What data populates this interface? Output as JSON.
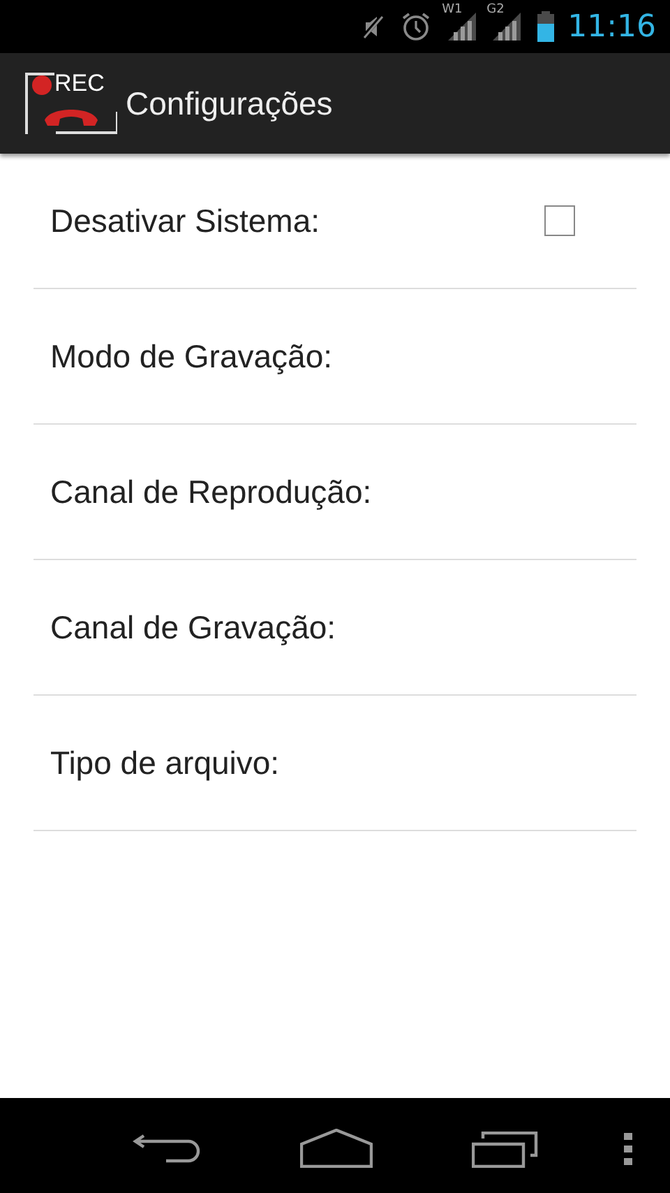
{
  "status_bar": {
    "signals": [
      "W1",
      "G2"
    ],
    "time": "11:16"
  },
  "action_bar": {
    "logo_text": "REC",
    "title": "Configurações"
  },
  "settings": [
    {
      "kind": "checkbox",
      "label": "Desativar Sistema:",
      "checked": false
    },
    {
      "kind": "plain",
      "label": "Modo de Gravação:"
    },
    {
      "kind": "plain",
      "label": "Canal de Reprodução:"
    },
    {
      "kind": "plain",
      "label": "Canal de Gravação:"
    },
    {
      "kind": "plain",
      "label": "Tipo de arquivo:"
    }
  ]
}
